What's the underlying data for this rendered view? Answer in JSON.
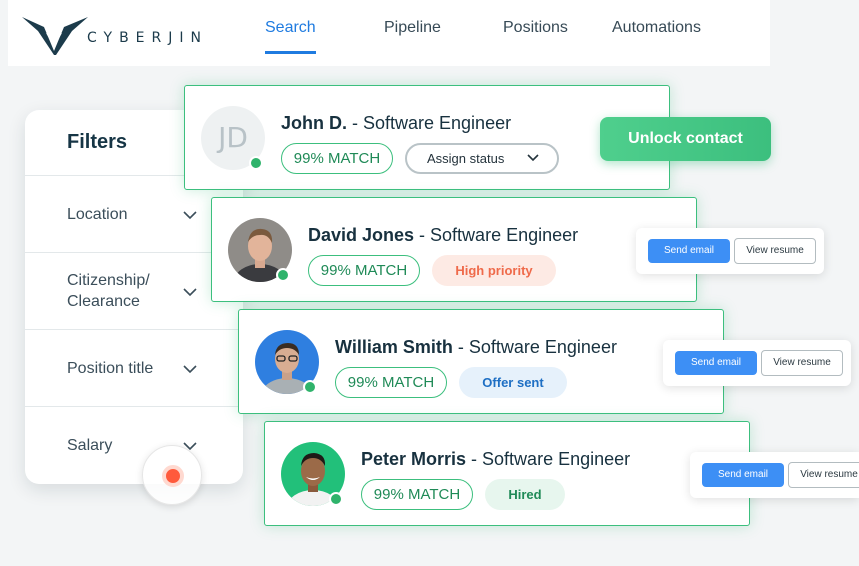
{
  "brand": {
    "name": "CYBERJIN",
    "accent": "#1f7be0",
    "logo_color": "#1c3b4b"
  },
  "nav": {
    "items": [
      {
        "label": "Search",
        "active": true
      },
      {
        "label": "Pipeline"
      },
      {
        "label": "Positions"
      },
      {
        "label": "Automations"
      }
    ]
  },
  "filters": {
    "title": "Filters",
    "items": [
      {
        "label": "Location"
      },
      {
        "label": "Citizenship/\nClearance"
      },
      {
        "label": "Position title"
      },
      {
        "label": "Salary"
      }
    ]
  },
  "candidates": [
    {
      "initials": "JD",
      "name": "John D.",
      "title": " - Software Engineer",
      "match": "99% MATCH",
      "status": "Assign status"
    },
    {
      "name": "David Jones",
      "title": " - Software Engineer",
      "match": "99% MATCH",
      "status": "High priority"
    },
    {
      "name": "William Smith",
      "title": " - Software Engineer",
      "match": "99% MATCH",
      "status": "Offer sent"
    },
    {
      "name": "Peter Morris",
      "title": " - Software Engineer",
      "match": "99% MATCH",
      "status": "Hired"
    }
  ],
  "actions": {
    "unlock_label": "Unlock contact",
    "send_email_label": "Send email",
    "view_resume_label": "View resume"
  },
  "colors": {
    "match_green": "#3cbf7e",
    "high_priority": "#ef6a4a",
    "offer_sent": "#1e6fc4",
    "hired": "#1f8a57",
    "send_btn": "#3d8ff5"
  }
}
